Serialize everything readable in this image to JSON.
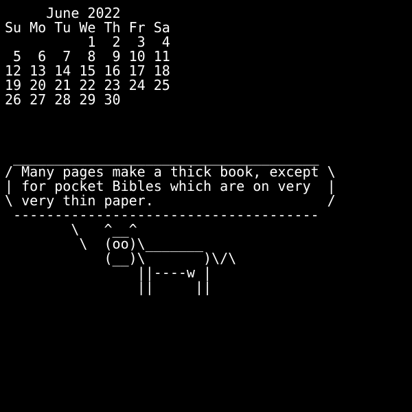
{
  "calendar": {
    "title": "     June 2022",
    "weekdays": "Su Mo Tu We Th Fr Sa",
    "rows": [
      "          1  2  3  4",
      " 5  6  7  8  9 10 11",
      "12 13 14 15 16 17 18",
      "19 20 21 22 23 24 25",
      "26 27 28 29 30"
    ]
  },
  "cowsay": {
    "bubble": [
      " _____________________________________",
      "/ Many pages make a thick book, except \\",
      "| for pocket Bibles which are on very  |",
      "\\ very thin paper.                     /",
      " -------------------------------------"
    ],
    "cow": [
      "        \\   ^__^",
      "         \\  (oo)\\_______",
      "            (__)\\       )\\/\\",
      "                ||----w |",
      "                ||     ||"
    ]
  }
}
